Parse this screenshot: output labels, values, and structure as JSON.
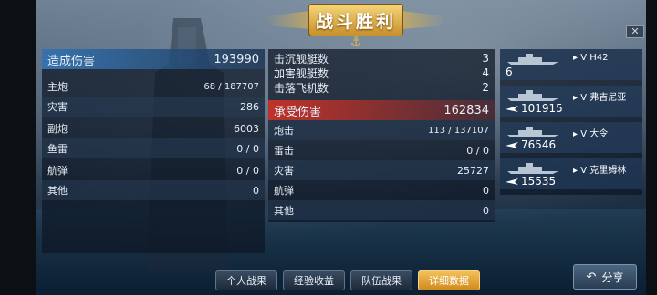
{
  "header": {
    "title": "战斗胜利"
  },
  "close": {
    "label": "✕"
  },
  "left_panel": {
    "head": {
      "label": "造成伤害",
      "value": "193990"
    },
    "rows": [
      {
        "label": "主炮",
        "value": "68 / 187707"
      },
      {
        "label": "灾害",
        "value": "286"
      },
      {
        "label": "副炮",
        "value": "6003"
      },
      {
        "label": "鱼雷",
        "value": "0 / 0"
      },
      {
        "label": "航弹",
        "value": "0 / 0"
      },
      {
        "label": "其他",
        "value": "0"
      }
    ]
  },
  "mid_panel": {
    "stats": [
      {
        "label": "击沉舰艇数",
        "value": "3"
      },
      {
        "label": "加害舰艇数",
        "value": "4"
      },
      {
        "label": "击落飞机数",
        "value": "2"
      }
    ],
    "head": {
      "label": "承受伤害",
      "value": "162834"
    },
    "rows": [
      {
        "label": "炮击",
        "value": "113 / 137107"
      },
      {
        "label": "雷击",
        "value": "0 / 0"
      },
      {
        "label": "灾害",
        "value": "25727"
      },
      {
        "label": "航弹",
        "value": "0"
      },
      {
        "label": "其他",
        "value": "0"
      }
    ]
  },
  "ships": [
    {
      "tag": "V",
      "name": "H42",
      "value": "6",
      "plane": false
    },
    {
      "tag": "V",
      "name": "弗吉尼亚",
      "value": "101915",
      "plane": true
    },
    {
      "tag": "V",
      "name": "大令",
      "value": "76546",
      "plane": true
    },
    {
      "tag": "V",
      "name": "克里姆林",
      "value": "15535",
      "plane": true
    }
  ],
  "tabs": [
    {
      "label": "个人战果",
      "active": false
    },
    {
      "label": "经验收益",
      "active": false
    },
    {
      "label": "队伍战果",
      "active": false
    },
    {
      "label": "详细数据",
      "active": true
    }
  ],
  "share": {
    "label": "分享"
  },
  "colors": {
    "accent_gold": "#e3b54a",
    "damage_blue": "#3c82c8",
    "received_red": "#c83228"
  }
}
